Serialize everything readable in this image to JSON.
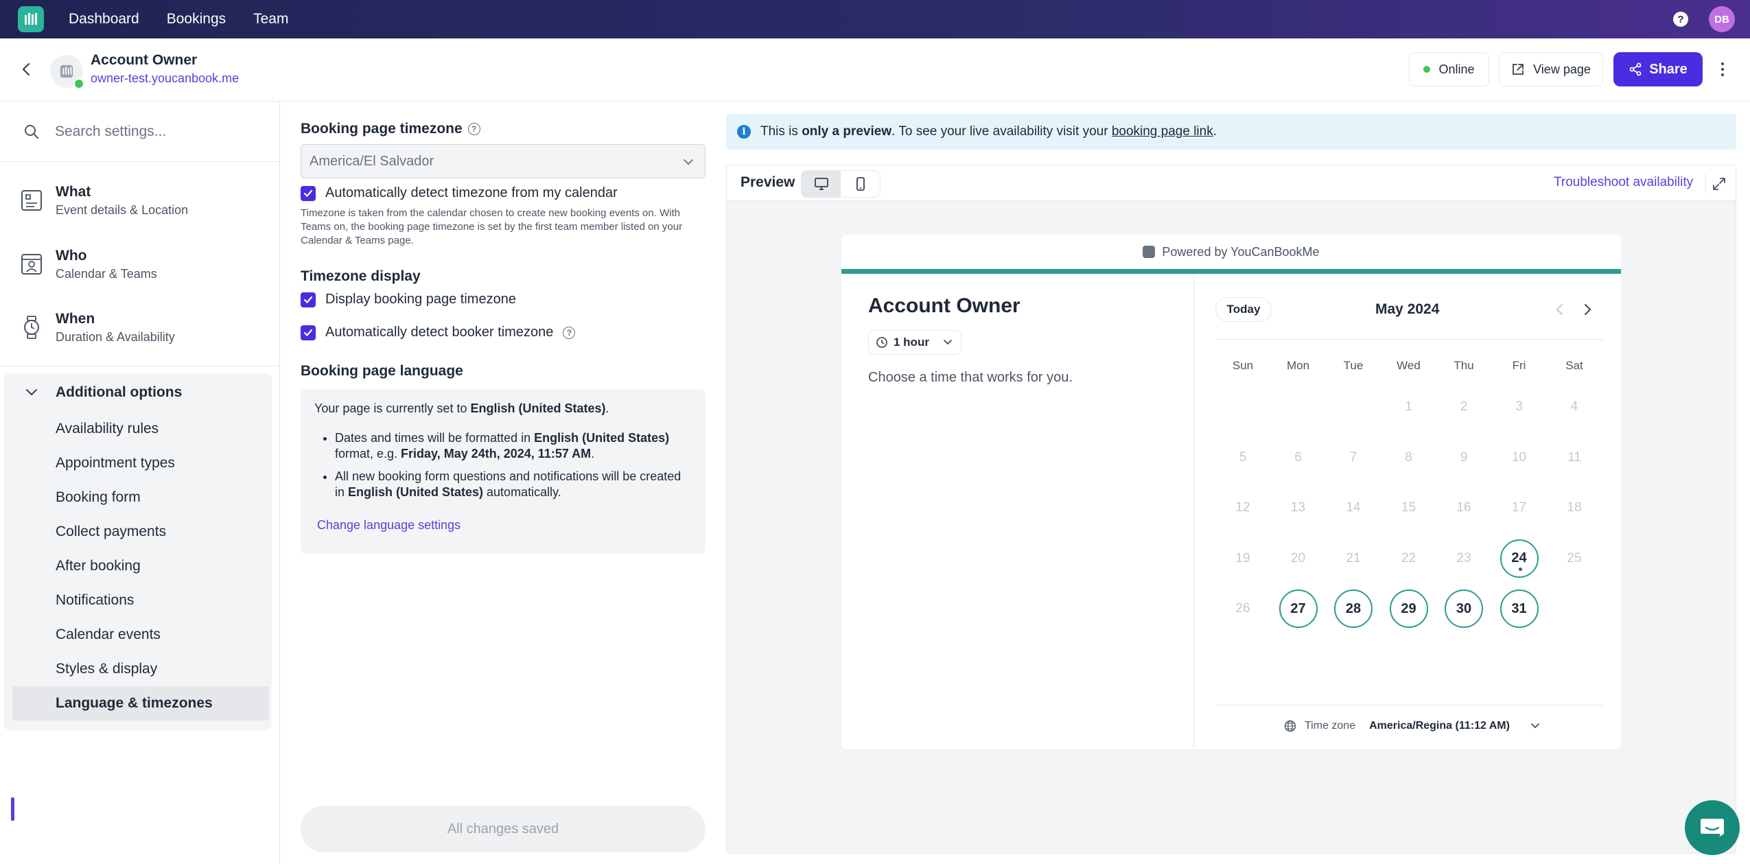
{
  "topnav": {
    "items": [
      "Dashboard",
      "Bookings",
      "Team"
    ],
    "help": "?",
    "avatar_initials": "DB"
  },
  "header": {
    "account_name": "Account Owner",
    "account_url": "owner-test.youcanbook.me",
    "status_label": "Online",
    "view_page_label": "View page",
    "share_label": "Share"
  },
  "sidebar": {
    "search_placeholder": "Search settings...",
    "sections": [
      {
        "title": "What",
        "subtitle": "Event details & Location"
      },
      {
        "title": "Who",
        "subtitle": "Calendar & Teams"
      },
      {
        "title": "When",
        "subtitle": "Duration & Availability"
      }
    ],
    "additional_label": "Additional options",
    "additional_items": [
      "Availability rules",
      "Appointment types",
      "Booking form",
      "Collect payments",
      "After booking",
      "Notifications",
      "Calendar events",
      "Styles & display",
      "Language & timezones"
    ]
  },
  "middle": {
    "tz_heading": "Booking page timezone",
    "tz_value": "America/El Salvador",
    "auto_detect_label": "Automatically detect timezone from my calendar",
    "help_text": "Timezone is taken from the calendar chosen to create new booking events on. With Teams on, the booking page timezone is set by the first team member listed on your Calendar & Teams page.",
    "display_heading": "Timezone display",
    "display_tz_label": "Display booking page timezone",
    "booker_tz_label": "Automatically detect booker timezone",
    "lang_heading": "Booking page language",
    "lang_intro_prefix": "Your page is currently set to ",
    "lang_name": "English (United States)",
    "lang_intro_suffix": ".",
    "bullet1_prefix": "Dates and times will be formatted in ",
    "bullet1_mid": " format, e.g. ",
    "bullet1_example": "Friday, May 24th, 2024, 11:57 AM",
    "bullet1_suffix": ".",
    "bullet2_prefix": "All new booking form questions and notifications will be created in ",
    "bullet2_suffix": " automatically.",
    "change_lang_link": "Change language settings",
    "saved_label": "All changes saved"
  },
  "preview": {
    "info_prefix": "This is ",
    "info_bold": "only a preview",
    "info_mid": ". To see your live availability visit your ",
    "info_link": "booking page link",
    "info_suffix": ".",
    "title": "Preview",
    "troubleshoot_label": "Troubleshoot availability",
    "powered_by": "Powered by YouCanBookMe",
    "booking_name": "Account Owner",
    "duration": "1 hour",
    "choose_text": "Choose a time that works for you.",
    "today_label": "Today",
    "month_label": "May 2024",
    "weekdays": [
      "Sun",
      "Mon",
      "Tue",
      "Wed",
      "Thu",
      "Fri",
      "Sat"
    ],
    "first_weekday_index": 3,
    "days_in_month": 31,
    "available_days": [
      24,
      27,
      28,
      29,
      30,
      31
    ],
    "today_day": 24,
    "timezone_label": "Time zone",
    "timezone_value": "America/Regina (11:12 AM)"
  },
  "colors": {
    "brand": "#4a2de0",
    "teal": "#2a9d8f",
    "link": "#5b3fd9",
    "online": "#3fc55b"
  }
}
